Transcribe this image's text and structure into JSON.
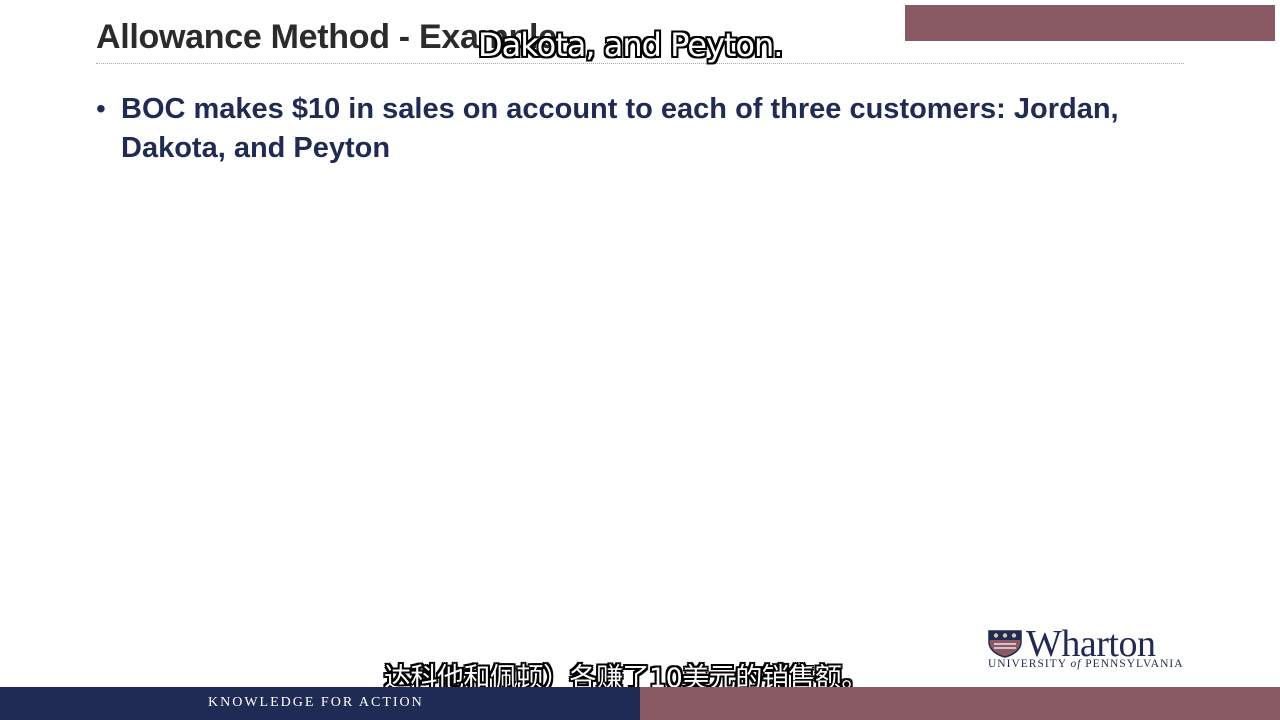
{
  "slide": {
    "title": "Allowance Method - Example",
    "bullets": [
      "BOC makes $10 in sales on account to each of three customers: Jordan, Dakota, and Peyton"
    ]
  },
  "subtitles": {
    "top": "Dakota, and Peyton.",
    "bottom": "达科他和佩顿）各赚了10美元的销售额。"
  },
  "logo": {
    "name": "Wharton",
    "university_prefix": "UNIVERSITY",
    "university_of": "of",
    "university_suffix": "PENNSYLVANIA"
  },
  "footer": {
    "tagline": "KNOWLEDGE FOR ACTION"
  },
  "colors": {
    "navy": "#1f2a55",
    "mauve": "#8a5a64",
    "title_text": "#2b2b2b"
  }
}
